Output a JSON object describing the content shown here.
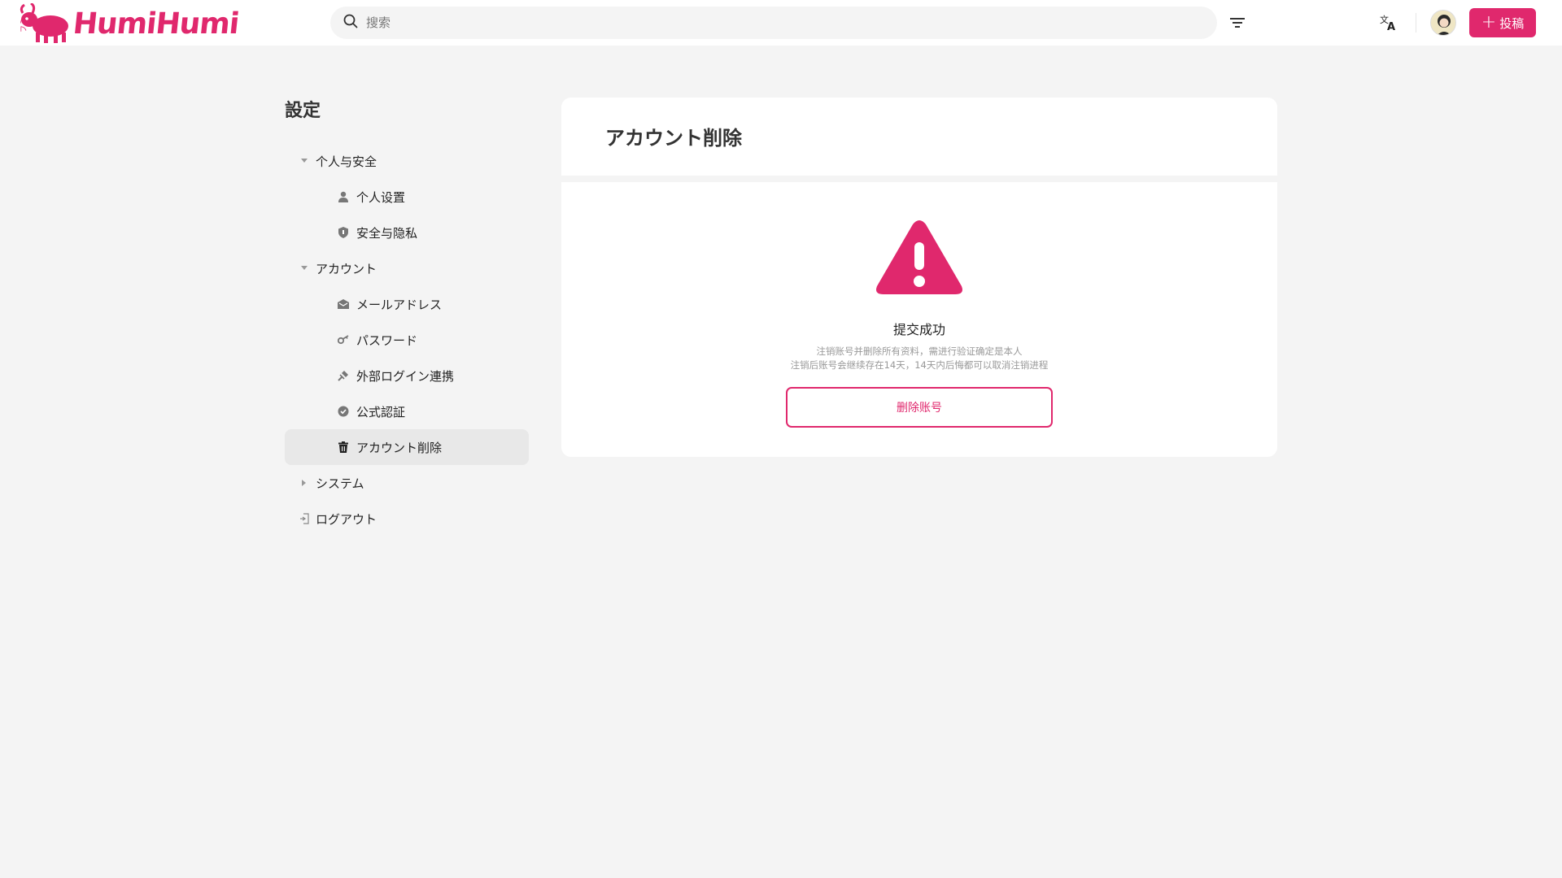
{
  "brand": {
    "name": "HumiHumi",
    "color": "#e0286d"
  },
  "header": {
    "search_placeholder": "搜索",
    "post_label": "投稿",
    "icons": [
      "search-icon",
      "filter-icon",
      "translate-icon",
      "avatar",
      "plus-icon"
    ]
  },
  "sidebar": {
    "title": "設定",
    "groups": [
      {
        "label": "个人与安全",
        "expanded": true,
        "items": [
          {
            "label": "个人设置",
            "icon": "person-icon"
          },
          {
            "label": "安全与隐私",
            "icon": "shield-icon"
          }
        ]
      },
      {
        "label": "アカウント",
        "expanded": true,
        "items": [
          {
            "label": "メールアドレス",
            "icon": "mail-icon"
          },
          {
            "label": "パスワード",
            "icon": "key-icon"
          },
          {
            "label": "外部ログイン連携",
            "icon": "link-icon"
          },
          {
            "label": "公式認証",
            "icon": "verified-icon"
          },
          {
            "label": "アカウント削除",
            "icon": "trash-icon",
            "active": true
          }
        ]
      },
      {
        "label": "システム",
        "expanded": false,
        "items": []
      }
    ],
    "logout_label": "ログアウト"
  },
  "main": {
    "title": "アカウント削除",
    "result_title": "提交成功",
    "desc_line1": "注销账号并删除所有资料，需进行验证确定是本人",
    "desc_line2": "注销后账号会继续存在14天，14天内后悔都可以取消注销进程",
    "delete_button": "删除账号",
    "warning_color": "#e0286d"
  }
}
